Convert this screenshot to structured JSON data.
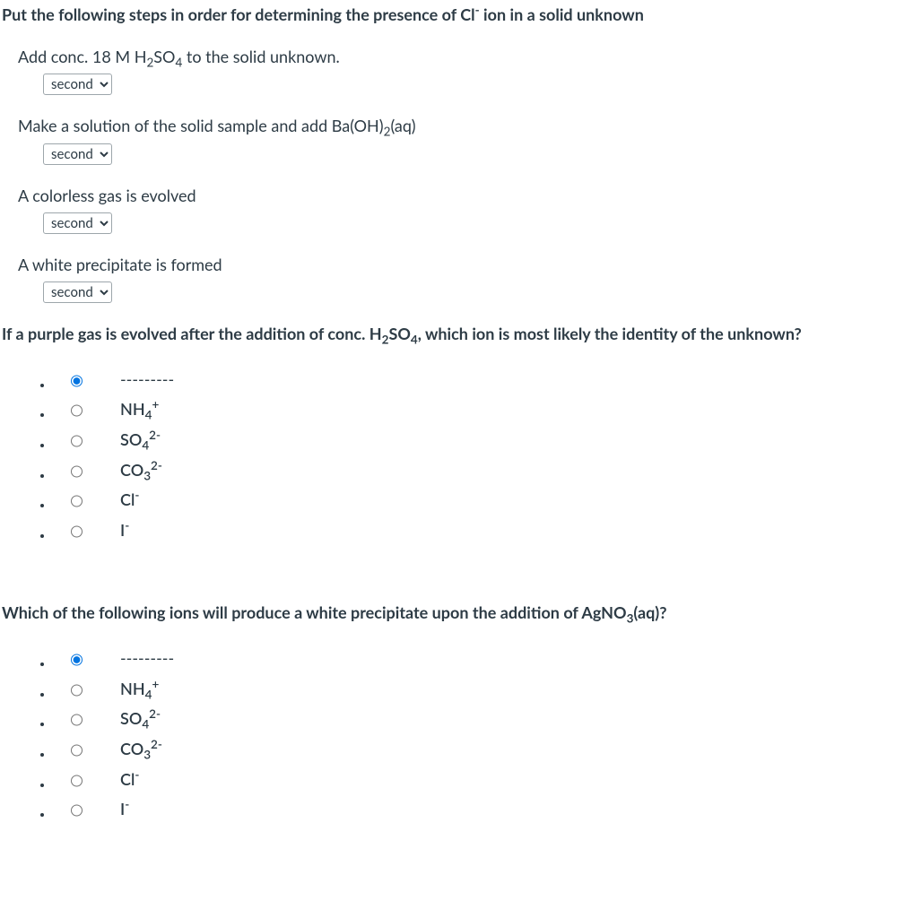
{
  "q1": {
    "title_pre": "Put the following steps in order for determining the presence of Cl",
    "title_sup": "-",
    "title_post": " ion in a solid unknown",
    "items": [
      {
        "text_pre": "Add conc. 18 M H",
        "text_sub1": "2",
        "text_mid": "SO",
        "text_sub2": "4",
        "text_post": " to the solid unknown.",
        "select": "second"
      },
      {
        "text_pre": "Make a solution of the solid sample and add Ba(OH)",
        "text_sub1": "2",
        "text_mid": "(aq)",
        "text_sub2": "",
        "text_post": "",
        "select": "second"
      },
      {
        "text_pre": "A colorless gas is evolved",
        "text_sub1": "",
        "text_mid": "",
        "text_sub2": "",
        "text_post": "",
        "select": "second"
      },
      {
        "text_pre": "A white precipitate is formed",
        "text_sub1": "",
        "text_mid": "",
        "text_sub2": "",
        "text_post": "",
        "select": "second"
      }
    ]
  },
  "q2": {
    "title_pre": "If a purple gas is evolved after the addition of conc. H",
    "title_sub1": "2",
    "title_mid": "SO",
    "title_sub2": "4",
    "title_post": ", which ion is most likely the identity of the unknown?",
    "options": {
      "blank": "---------",
      "nh4": {
        "base": "NH",
        "sub": "4",
        "sup": "+"
      },
      "so4": {
        "base": "SO",
        "sub": "4",
        "sup": "2-"
      },
      "co3": {
        "base": "CO",
        "sub": "3",
        "sup": "2-"
      },
      "cl": {
        "base": "Cl",
        "sup": "-"
      },
      "i": {
        "base": "I",
        "sup": "-"
      }
    }
  },
  "q3": {
    "title_pre": "Which of the following ions will produce a white precipitate upon the addition of AgNO",
    "title_sub": "3",
    "title_post": "(aq)?",
    "options": {
      "blank": "---------",
      "nh4": {
        "base": "NH",
        "sub": "4",
        "sup": "+"
      },
      "so4": {
        "base": "SO",
        "sub": "4",
        "sup": "2-"
      },
      "co3": {
        "base": "CO",
        "sub": "3",
        "sup": "2-"
      },
      "cl": {
        "base": "Cl",
        "sup": "-"
      },
      "i": {
        "base": "I",
        "sup": "-"
      }
    }
  }
}
